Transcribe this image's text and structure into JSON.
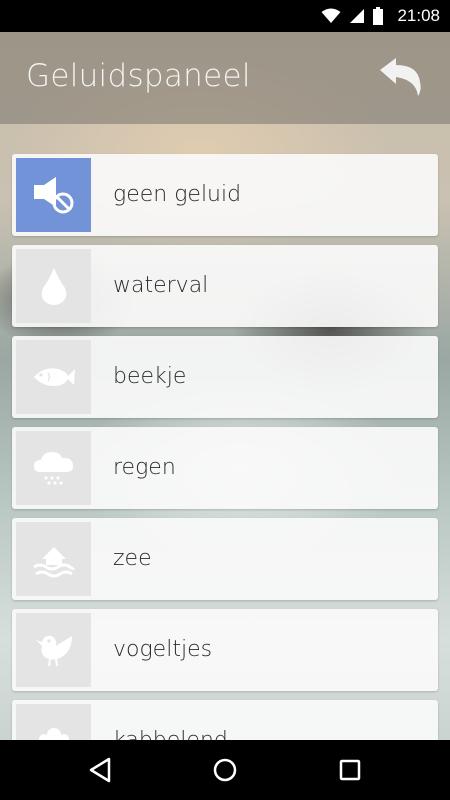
{
  "status_bar": {
    "time": "21:08",
    "icons": [
      "wifi-icon",
      "signal-icon",
      "battery-icon"
    ]
  },
  "app_bar": {
    "title": "Geluidspaneel",
    "back_icon": "undo-arrow-icon"
  },
  "sounds": [
    {
      "label": "geen geluid",
      "icon": "mute-speaker-icon",
      "selected": true
    },
    {
      "label": "waterval",
      "icon": "water-drop-icon",
      "selected": false
    },
    {
      "label": "beekje",
      "icon": "fish-icon",
      "selected": false
    },
    {
      "label": "regen",
      "icon": "rain-cloud-icon",
      "selected": false
    },
    {
      "label": "zee",
      "icon": "sea-waves-icon",
      "selected": false
    },
    {
      "label": "vogeltjes",
      "icon": "bird-icon",
      "selected": false
    },
    {
      "label": "kabbelend",
      "icon": "bubbles-icon",
      "selected": false
    }
  ],
  "colors": {
    "selected_tile": "#7393d8",
    "tile": "#e4e4e4",
    "status_bar": "#000000"
  },
  "nav_bar": {
    "buttons": [
      "back-triangle-icon",
      "home-circle-icon",
      "recents-square-icon"
    ]
  }
}
